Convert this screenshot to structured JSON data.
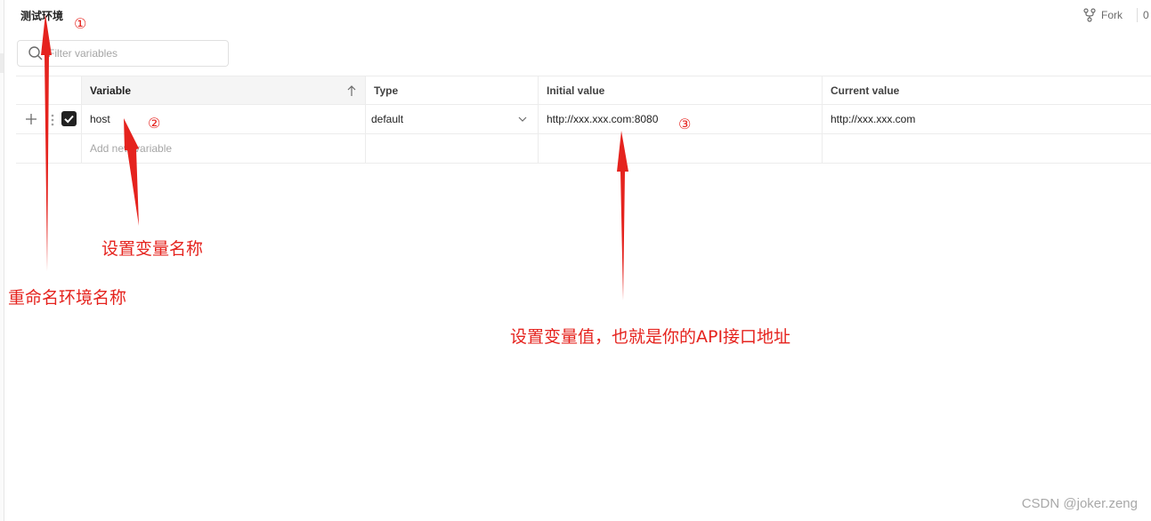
{
  "environment": {
    "title": "测试环境"
  },
  "header": {
    "fork_label": "Fork",
    "fork_count": "0"
  },
  "search": {
    "placeholder": "Filter variables"
  },
  "table": {
    "columns": [
      "Variable",
      "Type",
      "Initial value",
      "Current value"
    ],
    "rows": [
      {
        "enabled": true,
        "variable": "host",
        "type": "default",
        "initial_value": "http://xxx.xxx.com:8080",
        "current_value": "http://xxx.xxx.com"
      }
    ],
    "add_placeholder": "Add new variable"
  },
  "annotations": {
    "marker_1": "①",
    "marker_2": "②",
    "marker_3": "③",
    "note_rename": "重命名环境名称",
    "note_set_name": "设置变量名称",
    "note_set_value": "设置变量值，也就是你的API接口地址",
    "color": "#e5231e"
  },
  "watermark": "CSDN @joker.zeng",
  "icons": {
    "fork": "fork-icon",
    "search": "search-icon",
    "sort": "arrow-up-icon",
    "add": "plus-icon",
    "drag": "drag-handle-icon",
    "check": "checkbox-checked-icon",
    "dropdown": "chevron-down-icon"
  }
}
